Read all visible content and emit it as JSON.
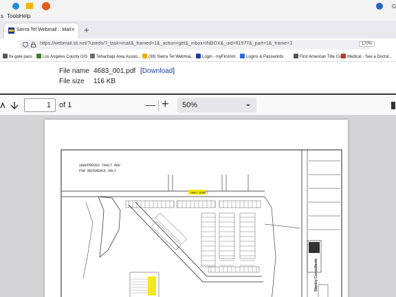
{
  "menu": {
    "file_partial": "s",
    "tools": "Tools",
    "help": "Help"
  },
  "tab": {
    "title": "Sierra Tel Webmail :: Mail",
    "close": "×",
    "new_tab": "+"
  },
  "address": {
    "url": "https://webmail.sti.net/?uxedo/?_task=mail&_framed=1&_action=get&_mbox=INBOX&_uid=61977&_part=1&_frame=1",
    "zoom": "170%"
  },
  "bookmarks": [
    {
      "label": "bv gate pass",
      "color": "#555555"
    },
    {
      "label": "Los Angeles County GIS",
      "color": "#3a7d2c"
    },
    {
      "label": "Tehachapi Area Associ...",
      "color": "#6b6b6b"
    },
    {
      "label": "(38) Sierra Tel Webmai...",
      "color": "#e8b400"
    },
    {
      "label": "Login - myFirstAm",
      "color": "#1a3aa8"
    },
    {
      "label": "Logins & Passwords",
      "color": "#2a6ad8"
    },
    {
      "label": "First American Title Co...",
      "color": "#555555"
    },
    {
      "label": "Medical - See a Doctor...",
      "color": "#c0392b"
    }
  ],
  "file_info": {
    "name_label": "File name",
    "name_value": "4683_001.pdf",
    "download_open": "[",
    "download_label": "Download",
    "download_close": "]",
    "size_label": "File size",
    "size_value": "116 KB"
  },
  "pdf_toolbar": {
    "page_number": "1",
    "page_total": "of 1",
    "zoom_value": "50%",
    "zoom_minus": "—",
    "zoom_plus": "+"
  },
  "map": {
    "title_line1": "UNAPPROVED TRACT MAP",
    "title_line2": "FOR REFERENCE ONLY",
    "street_label": "TRACT STREET",
    "firm_name": "Stanley Consultants"
  },
  "colors": {
    "street_highlight": "#f2e600",
    "tab_bg": "#e9e9ef",
    "viewer_bg": "#d4d4d7"
  }
}
